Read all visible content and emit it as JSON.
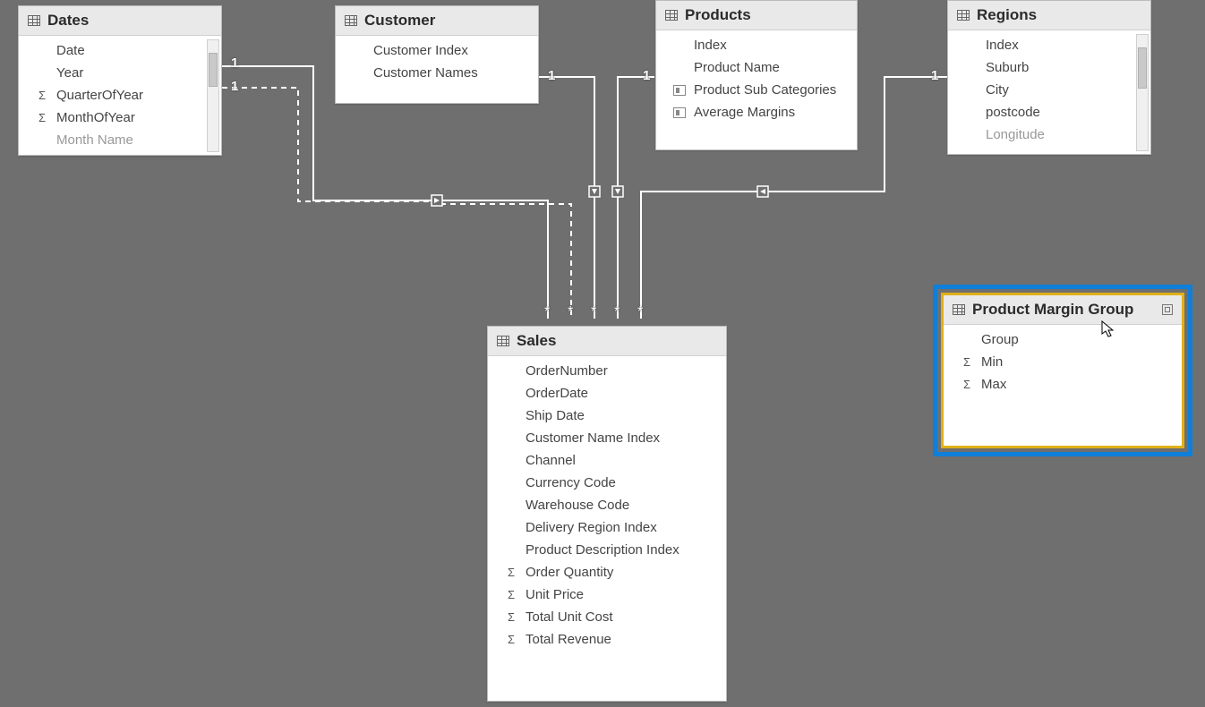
{
  "tables": {
    "dates": {
      "title": "Dates",
      "fields": [
        {
          "label": "Date",
          "icon": ""
        },
        {
          "label": "Year",
          "icon": ""
        },
        {
          "label": "QuarterOfYear",
          "icon": "sigma"
        },
        {
          "label": "MonthOfYear",
          "icon": "sigma"
        },
        {
          "label": "Month Name",
          "icon": ""
        }
      ]
    },
    "customer": {
      "title": "Customer",
      "fields": [
        {
          "label": "Customer Index",
          "icon": ""
        },
        {
          "label": "Customer Names",
          "icon": ""
        }
      ]
    },
    "products": {
      "title": "Products",
      "fields": [
        {
          "label": "Index",
          "icon": ""
        },
        {
          "label": "Product Name",
          "icon": ""
        },
        {
          "label": "Product Sub Categories",
          "icon": "cat"
        },
        {
          "label": "Average Margins",
          "icon": "cat"
        }
      ]
    },
    "regions": {
      "title": "Regions",
      "fields": [
        {
          "label": "Index",
          "icon": ""
        },
        {
          "label": "Suburb",
          "icon": ""
        },
        {
          "label": "City",
          "icon": ""
        },
        {
          "label": "postcode",
          "icon": ""
        },
        {
          "label": "Longitude",
          "icon": ""
        }
      ]
    },
    "sales": {
      "title": "Sales",
      "fields": [
        {
          "label": "OrderNumber",
          "icon": ""
        },
        {
          "label": "OrderDate",
          "icon": ""
        },
        {
          "label": "Ship Date",
          "icon": ""
        },
        {
          "label": "Customer Name Index",
          "icon": ""
        },
        {
          "label": "Channel",
          "icon": ""
        },
        {
          "label": "Currency Code",
          "icon": ""
        },
        {
          "label": "Warehouse Code",
          "icon": ""
        },
        {
          "label": "Delivery Region Index",
          "icon": ""
        },
        {
          "label": "Product Description Index",
          "icon": ""
        },
        {
          "label": "Order Quantity",
          "icon": "sigma"
        },
        {
          "label": "Unit Price",
          "icon": "sigma"
        },
        {
          "label": "Total Unit Cost",
          "icon": "sigma"
        },
        {
          "label": "Total Revenue",
          "icon": "sigma"
        }
      ]
    },
    "pmg": {
      "title": "Product Margin Group",
      "fields": [
        {
          "label": "Group",
          "icon": ""
        },
        {
          "label": "Min",
          "icon": "sigma"
        },
        {
          "label": "Max",
          "icon": "sigma"
        }
      ]
    }
  },
  "cardinality": {
    "one": "1",
    "many": "*"
  },
  "relationships": [
    {
      "from": "Dates",
      "to": "Sales",
      "from_card": "1",
      "to_card": "*",
      "type": "active"
    },
    {
      "from": "Dates",
      "to": "Sales",
      "from_card": "1",
      "to_card": "*",
      "type": "inactive"
    },
    {
      "from": "Customer",
      "to": "Sales",
      "from_card": "1",
      "to_card": "*",
      "type": "active"
    },
    {
      "from": "Products",
      "to": "Sales",
      "from_card": "1",
      "to_card": "*",
      "type": "active"
    },
    {
      "from": "Regions",
      "to": "Sales",
      "from_card": "1",
      "to_card": "*",
      "type": "active"
    }
  ]
}
